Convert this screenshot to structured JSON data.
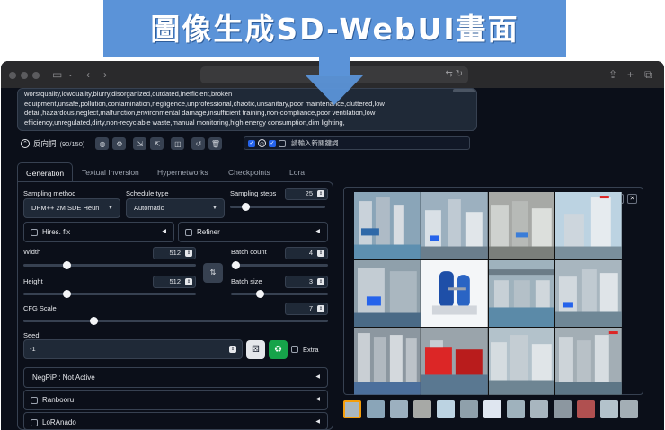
{
  "banner": {
    "title": "圖像生成SD-WebUI畫面"
  },
  "prompt": {
    "text": "worstquality,lowquality,blurry,disorganized,outdated,inefficient,broken equipment,unsafe,pollution,contamination,negligence,unprofessional,chaotic,unsanitary,poor maintenance,cluttered,low detail,hazardous,neglect,malfunction,environmental damage,insufficient training,non-compliance,poor ventilation,low efficiency,unregulated,dirty,non-recyclable waste,manual monitoring,high energy consumption,dim lighting,"
  },
  "negative": {
    "label": "反向詞",
    "count": "(90/150)",
    "keyword_placeholder": "請輸入新關鍵詞"
  },
  "tabs": [
    "Generation",
    "Textual Inversion",
    "Hypernetworks",
    "Checkpoints",
    "Lora"
  ],
  "params": {
    "sampling_method_label": "Sampling method",
    "sampling_method": "DPM++ 2M SDE Heun",
    "schedule_type_label": "Schedule type",
    "schedule_type": "Automatic",
    "sampling_steps_label": "Sampling steps",
    "sampling_steps": "25",
    "hires_label": "Hires. fix",
    "refiner_label": "Refiner",
    "width_label": "Width",
    "width": "512",
    "height_label": "Height",
    "height": "512",
    "batch_count_label": "Batch count",
    "batch_count": "4",
    "batch_size_label": "Batch size",
    "batch_size": "3",
    "cfg_label": "CFG Scale",
    "cfg": "7",
    "seed_label": "Seed",
    "seed": "-1",
    "extra_label": "Extra"
  },
  "sliders": {
    "sampling_steps": 0.16,
    "width": 0.25,
    "height": 0.25,
    "batch_count": 0.05,
    "batch_size": 0.3,
    "cfg": 0.23
  },
  "accordions": {
    "negpip": "NegPiP : Not Active",
    "ranbooru": "Ranbooru",
    "loranado": "LoRAnado"
  },
  "colors": {
    "banner": "#5b93d8",
    "window_bg": "#0b0f19",
    "panel_border": "#374151",
    "accent_blue": "#2563eb",
    "recycle_green": "#16a34a",
    "thumb_selected": "#f59e0b"
  }
}
